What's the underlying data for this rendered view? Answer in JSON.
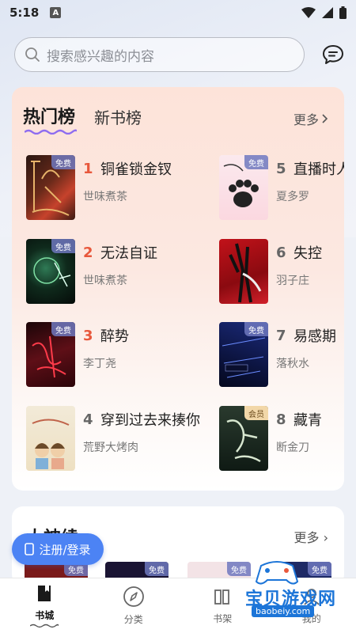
{
  "status_bar": {
    "time": "5:18",
    "indicator": "A"
  },
  "search": {
    "placeholder": "搜索感兴趣的内容"
  },
  "ranking": {
    "tab_active": "热门榜",
    "tab_inactive": "新书榜",
    "more": "更多",
    "items": [
      {
        "rank": "1",
        "title": "铜雀锁金钗",
        "author": "世味煮茶",
        "badge": "免费"
      },
      {
        "rank": "2",
        "title": "无法自证",
        "author": "世味煮茶",
        "badge": "免费"
      },
      {
        "rank": "3",
        "title": "醉势",
        "author": "李丁尧",
        "badge": "免费"
      },
      {
        "rank": "4",
        "title": "穿到过去来揍你",
        "author": "荒野大烤肉",
        "badge": ""
      },
      {
        "rank": "5",
        "title": "直播时人",
        "author": "夏多罗",
        "badge": "免费"
      },
      {
        "rank": "6",
        "title": "失控",
        "author": "羽子庄",
        "badge": ""
      },
      {
        "rank": "7",
        "title": "易感期",
        "author": "落秋水",
        "badge": "免费"
      },
      {
        "rank": "8",
        "title": "藏青",
        "author": "断金刀",
        "badge": "会员"
      }
    ]
  },
  "god_section": {
    "title": "大神续",
    "more": "更多",
    "badges": [
      "免费",
      "免费",
      "免费",
      "免费"
    ]
  },
  "register_button": "注册/登录",
  "nav": [
    {
      "label": "书城",
      "icon": "book-icon",
      "active": true
    },
    {
      "label": "分类",
      "icon": "compass-icon",
      "active": false
    },
    {
      "label": "书架",
      "icon": "bookshelf-icon",
      "active": false
    },
    {
      "label": "我的",
      "icon": "profile-icon",
      "active": false
    }
  ],
  "watermark": {
    "text": "宝贝游戏网",
    "url": "baobeiy.com"
  },
  "colors": {
    "accent": "#4c83f4",
    "hot_rank": "#e8583c"
  }
}
